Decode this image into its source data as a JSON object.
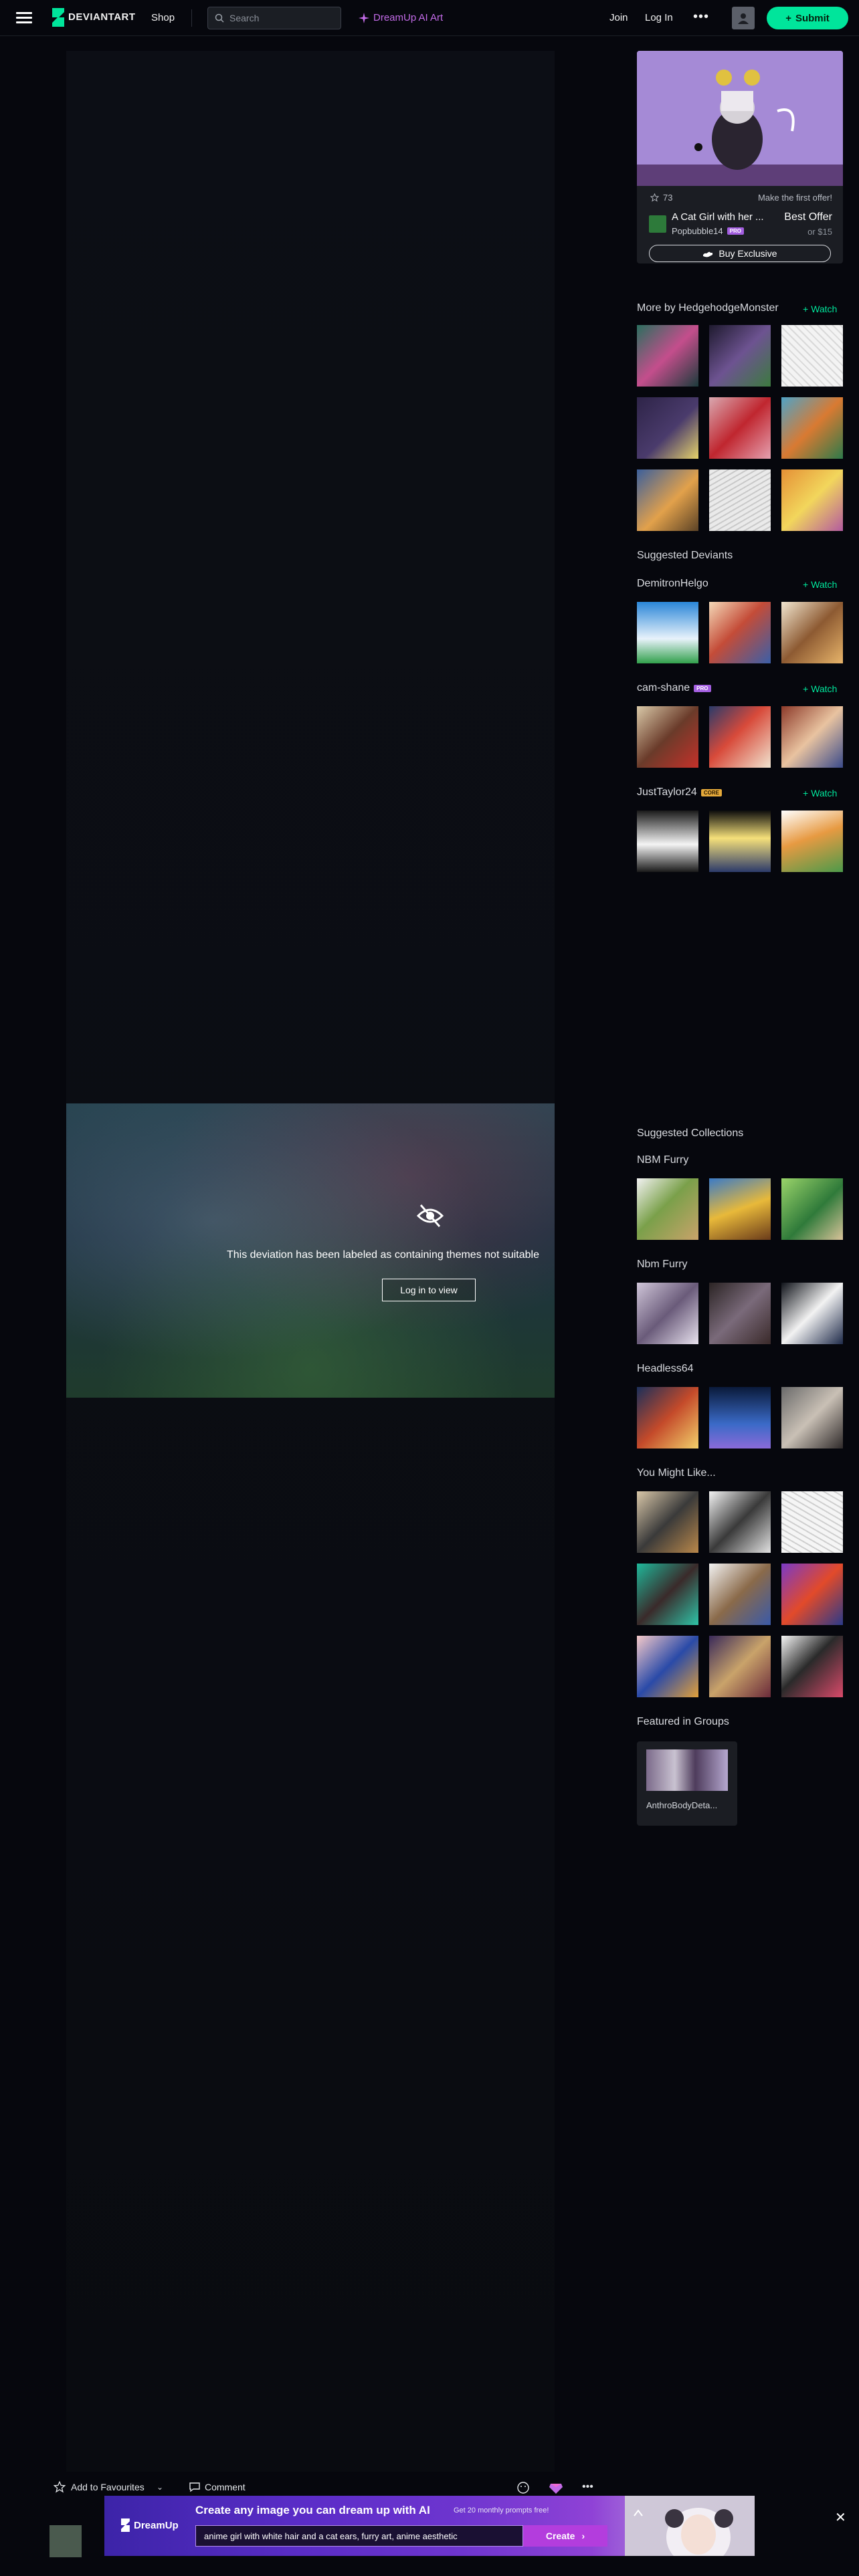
{
  "header": {
    "logo_text": "DEVIANTART",
    "shop": "Shop",
    "search_placeholder": "Search",
    "dreamup": "DreamUp AI Art",
    "join": "Join",
    "login": "Log In",
    "more": "•••",
    "submit": "Submit"
  },
  "deviation": {
    "mature_notice": "This deviation has been labeled as containing themes not suitable",
    "login_button": "Log in to view"
  },
  "offer": {
    "fav_count": "73",
    "cta": "Make the first offer!",
    "title": "A Cat Girl with her ...",
    "seller": "Popbubble14",
    "seller_badge": "PRO",
    "price": "Best Offer",
    "min_price": "or $15",
    "buy_button": "Buy Exclusive"
  },
  "more_by": {
    "title": "More by HedgehodgeMonster",
    "watch": "Watch"
  },
  "suggested_deviants": {
    "title": "Suggested Deviants",
    "deviants": [
      {
        "name": "DemitronHelgo",
        "badge": "",
        "watch": "Watch"
      },
      {
        "name": "cam-shane",
        "badge": "PRO",
        "watch": "Watch"
      },
      {
        "name": "JustTaylor24",
        "badge": "CORE",
        "watch": "Watch"
      }
    ]
  },
  "suggested_collections": {
    "title": "Suggested Collections",
    "collections": [
      "NBM Furry",
      "Nbm Furry",
      "Headless64"
    ]
  },
  "you_might_like": {
    "title": "You Might Like..."
  },
  "featured_groups": {
    "title": "Featured in Groups",
    "group_name": "AnthroBodyDeta..."
  },
  "bottom_bar": {
    "favourite": "Add to Favourites",
    "comment": "Comment",
    "more": "•••"
  },
  "banner": {
    "brand": "DreamUp",
    "headline": "Create any image you can dream up with AI",
    "sub": "Get 20 monthly prompts free!",
    "prompt_value": "anime girl with white hair and a cat ears, furry art, anime aesthetic",
    "create": "Create",
    "close": "✕"
  },
  "colors": {
    "accent_green": "#00e59b",
    "dreamup_purple": "#c36be8",
    "background": "#06070d"
  }
}
